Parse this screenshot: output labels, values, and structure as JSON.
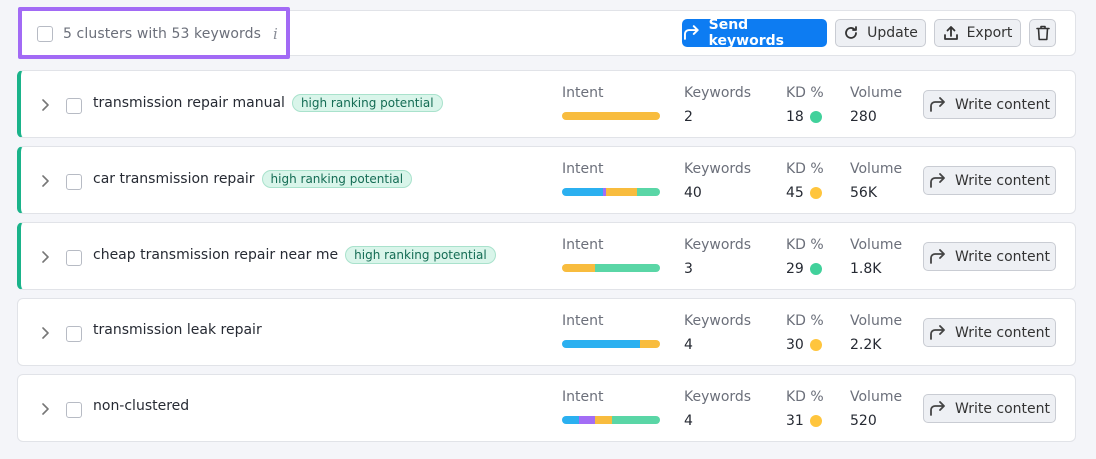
{
  "header": {
    "summary": "5 clusters with 53 keywords",
    "info_icon": "i",
    "send_label": "Send keywords",
    "update_label": "Update",
    "export_label": "Export"
  },
  "columns": {
    "intent": "Intent",
    "keywords": "Keywords",
    "kd": "KD %",
    "volume": "Volume"
  },
  "write_label": "Write content",
  "colors": {
    "primary": "#0d7cf2",
    "accent_green": "#1ab38a",
    "kd_green": "#41d19b",
    "kd_yellow": "#ffc53d",
    "intent_blue": "#2bb0f0",
    "intent_purple": "#a36df5",
    "intent_yellow": "#f8bc3e",
    "intent_green": "#5ad6a6",
    "highlight": "#a26af5"
  },
  "clusters": [
    {
      "title": "transmission repair manual",
      "badge": "high ranking potential",
      "keywords": "2",
      "kd": "18",
      "kd_color": "green",
      "volume": "280",
      "intent": [
        {
          "color": "yellow",
          "share": 1.0
        }
      ]
    },
    {
      "title": "car transmission repair",
      "badge": "high ranking potential",
      "keywords": "40",
      "kd": "45",
      "kd_color": "yellow",
      "volume": "56K",
      "intent": [
        {
          "color": "blue",
          "share": 0.42
        },
        {
          "color": "purple",
          "share": 0.03
        },
        {
          "color": "yellow",
          "share": 0.32
        },
        {
          "color": "green",
          "share": 0.23
        }
      ]
    },
    {
      "title": "cheap transmission repair near me",
      "badge": "high ranking potential",
      "keywords": "3",
      "kd": "29",
      "kd_color": "green",
      "volume": "1.8K",
      "intent": [
        {
          "color": "yellow",
          "share": 0.34
        },
        {
          "color": "green",
          "share": 0.66
        }
      ]
    },
    {
      "title": "transmission leak repair",
      "badge": "",
      "keywords": "4",
      "kd": "30",
      "kd_color": "yellow",
      "volume": "2.2K",
      "intent": [
        {
          "color": "blue",
          "share": 0.8
        },
        {
          "color": "yellow",
          "share": 0.2
        }
      ]
    },
    {
      "title": "non-clustered",
      "badge": "",
      "keywords": "4",
      "kd": "31",
      "kd_color": "yellow",
      "volume": "520",
      "intent": [
        {
          "color": "blue",
          "share": 0.17
        },
        {
          "color": "purple",
          "share": 0.17
        },
        {
          "color": "yellow",
          "share": 0.17
        },
        {
          "color": "green",
          "share": 0.49
        }
      ]
    }
  ]
}
